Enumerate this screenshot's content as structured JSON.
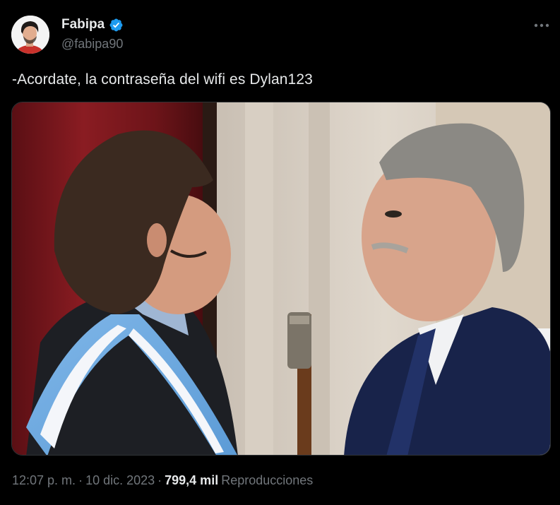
{
  "user": {
    "display_name": "Fabipa",
    "handle": "@fabipa90",
    "verified_color": "#1d9bf0"
  },
  "tweet": {
    "text": "-Acordate, la contraseña del wifi es Dylan123",
    "time": "12:07 p. m.",
    "separator": "·",
    "date": "10 dic. 2023",
    "views_count": "799,4 mil",
    "views_label": "Reproducciones"
  },
  "icons": {
    "more": "more-horizontal-icon",
    "verified": "verified-badge-icon"
  }
}
